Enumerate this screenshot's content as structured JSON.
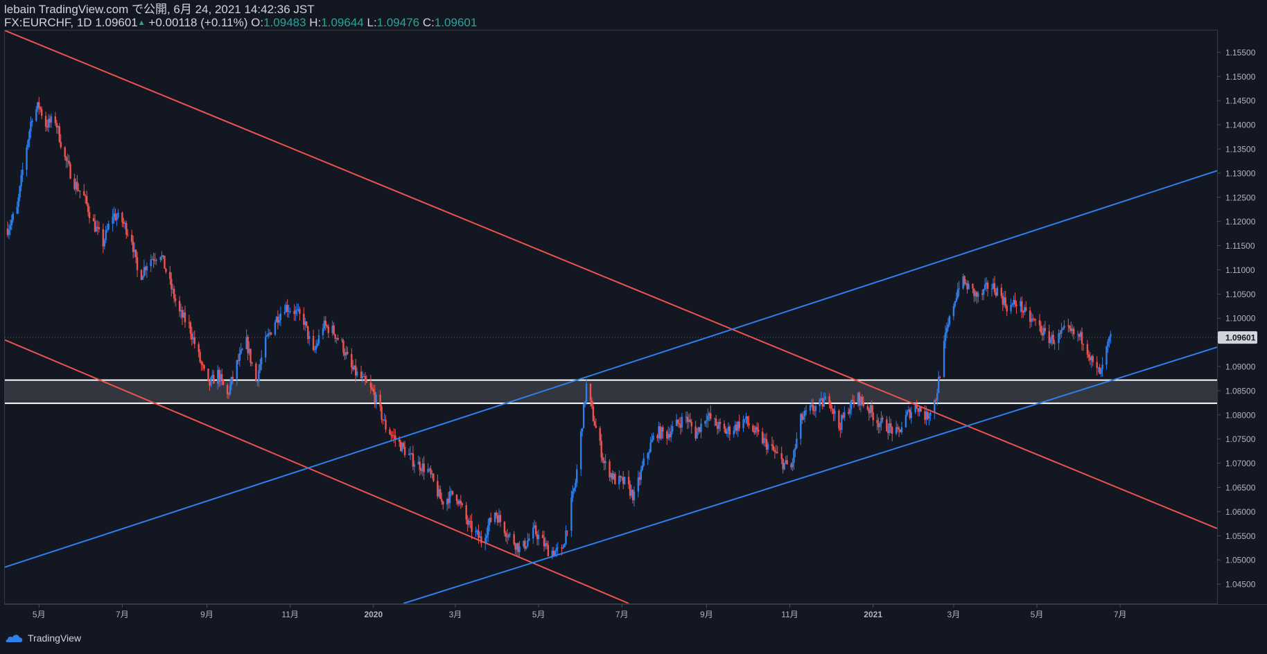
{
  "header": {
    "publish_line": "lebain TradingView.com で公開, 6月 24, 2021 14:42:36 JST",
    "symbol": "FX:EURCHF, 1D",
    "last": "1.09601",
    "change_arrow": "▲",
    "change": "+0.00118 (+0.11%)",
    "o_label": "O:",
    "o_value": "1.09483",
    "h_label": "H:",
    "h_value": "1.09644",
    "l_label": "L:",
    "l_value": "1.09476",
    "c_label": "C:",
    "c_value": "1.09601"
  },
  "footer": {
    "brand": "TradingView"
  },
  "colors": {
    "background": "#131722",
    "bull": "#2f80ed",
    "bear": "#ef5350",
    "zone_line": "#ffffff",
    "zone_fill": "#3a3c44",
    "axis_text": "#b2b5be",
    "price_tag": "#d1d4dc"
  },
  "chart_data": {
    "type": "candlestick",
    "symbol": "FX:EURCHF",
    "interval": "1D",
    "y_range": [
      1.041,
      1.1595
    ],
    "y_ticks": [
      "1.04500",
      "1.05000",
      "1.05500",
      "1.06000",
      "1.06500",
      "1.07000",
      "1.07500",
      "1.08000",
      "1.08500",
      "1.09000",
      "1.09500",
      "1.10000",
      "1.10500",
      "1.11000",
      "1.11500",
      "1.12000",
      "1.12500",
      "1.13000",
      "1.13500",
      "1.14000",
      "1.14500",
      "1.15000",
      "1.15500"
    ],
    "x_range": [
      "2019-04-06",
      "2021-09-10"
    ],
    "x_ticks": [
      {
        "date": "2019-05-01",
        "label": "5月"
      },
      {
        "date": "2019-07-01",
        "label": "7月"
      },
      {
        "date": "2019-09-01",
        "label": "9月"
      },
      {
        "date": "2019-11-01",
        "label": "11月"
      },
      {
        "date": "2020-01-01",
        "label": "2020"
      },
      {
        "date": "2020-03-01",
        "label": "3月"
      },
      {
        "date": "2020-05-01",
        "label": "5月"
      },
      {
        "date": "2020-07-01",
        "label": "7月"
      },
      {
        "date": "2020-09-01",
        "label": "9月"
      },
      {
        "date": "2020-11-01",
        "label": "11月"
      },
      {
        "date": "2021-01-01",
        "label": "2021"
      },
      {
        "date": "2021-03-01",
        "label": "3月"
      },
      {
        "date": "2021-05-01",
        "label": "5月"
      },
      {
        "date": "2021-07-01",
        "label": "7月"
      }
    ],
    "last_price": "1.09601",
    "close_path": [
      [
        "2019-04-08",
        1.1185
      ],
      [
        "2019-04-15",
        1.1225
      ],
      [
        "2019-04-20",
        1.1325
      ],
      [
        "2019-04-26",
        1.142
      ],
      [
        "2019-05-01",
        1.144
      ],
      [
        "2019-05-06",
        1.14
      ],
      [
        "2019-05-13",
        1.141
      ],
      [
        "2019-05-20",
        1.133
      ],
      [
        "2019-05-27",
        1.128
      ],
      [
        "2019-06-03",
        1.125
      ],
      [
        "2019-06-10",
        1.1195
      ],
      [
        "2019-06-17",
        1.1155
      ],
      [
        "2019-06-24",
        1.1215
      ],
      [
        "2019-07-01",
        1.12
      ],
      [
        "2019-07-08",
        1.1165
      ],
      [
        "2019-07-13",
        1.108
      ],
      [
        "2019-07-20",
        1.112
      ],
      [
        "2019-07-29",
        1.1135
      ],
      [
        "2019-08-05",
        1.107
      ],
      [
        "2019-08-12",
        1.101
      ],
      [
        "2019-08-19",
        1.0985
      ],
      [
        "2019-08-26",
        1.092
      ],
      [
        "2019-09-02",
        1.086
      ],
      [
        "2019-09-09",
        1.0885
      ],
      [
        "2019-09-16",
        1.084
      ],
      [
        "2019-09-23",
        1.0905
      ],
      [
        "2019-09-30",
        1.095
      ],
      [
        "2019-10-07",
        1.087
      ],
      [
        "2019-10-14",
        1.095
      ],
      [
        "2019-10-21",
        1.0995
      ],
      [
        "2019-10-28",
        1.1025
      ],
      [
        "2019-11-04",
        1.1015
      ],
      [
        "2019-11-11",
        1.0995
      ],
      [
        "2019-11-18",
        1.0925
      ],
      [
        "2019-11-25",
        1.0985
      ],
      [
        "2019-12-02",
        1.0975
      ],
      [
        "2019-12-09",
        1.0945
      ],
      [
        "2019-12-16",
        1.0895
      ],
      [
        "2019-12-23",
        1.0875
      ],
      [
        "2020-01-01",
        1.0845
      ],
      [
        "2020-01-10",
        1.0775
      ],
      [
        "2020-01-20",
        1.074
      ],
      [
        "2020-01-30",
        1.0705
      ],
      [
        "2020-02-10",
        1.0685
      ],
      [
        "2020-02-20",
        1.062
      ],
      [
        "2020-03-01",
        1.064
      ],
      [
        "2020-03-10",
        1.0575
      ],
      [
        "2020-03-20",
        1.054
      ],
      [
        "2020-03-30",
        1.06
      ],
      [
        "2020-04-08",
        1.0555
      ],
      [
        "2020-04-18",
        1.052
      ],
      [
        "2020-04-28",
        1.056
      ],
      [
        "2020-05-08",
        1.052
      ],
      [
        "2020-05-18",
        1.0515
      ],
      [
        "2020-05-28",
        1.066
      ],
      [
        "2020-06-05",
        1.086
      ],
      [
        "2020-06-10",
        1.0795
      ],
      [
        "2020-06-18",
        1.07
      ],
      [
        "2020-06-26",
        1.0665
      ],
      [
        "2020-07-03",
        1.066
      ],
      [
        "2020-07-10",
        1.063
      ],
      [
        "2020-07-18",
        1.071
      ],
      [
        "2020-07-26",
        1.0765
      ],
      [
        "2020-08-03",
        1.076
      ],
      [
        "2020-08-10",
        1.078
      ],
      [
        "2020-08-17",
        1.0795
      ],
      [
        "2020-08-24",
        1.076
      ],
      [
        "2020-09-01",
        1.08
      ],
      [
        "2020-09-08",
        1.078
      ],
      [
        "2020-09-15",
        1.0765
      ],
      [
        "2020-09-22",
        1.0775
      ],
      [
        "2020-09-29",
        1.079
      ],
      [
        "2020-10-06",
        1.0765
      ],
      [
        "2020-10-13",
        1.0745
      ],
      [
        "2020-10-20",
        1.0725
      ],
      [
        "2020-10-27",
        1.07
      ],
      [
        "2020-11-02",
        1.069
      ],
      [
        "2020-11-09",
        1.079
      ],
      [
        "2020-11-16",
        1.081
      ],
      [
        "2020-11-23",
        1.082
      ],
      [
        "2020-11-30",
        1.0835
      ],
      [
        "2020-12-07",
        1.0775
      ],
      [
        "2020-12-14",
        1.0815
      ],
      [
        "2020-12-21",
        1.0835
      ],
      [
        "2020-12-28",
        1.0815
      ],
      [
        "2021-01-05",
        1.0785
      ],
      [
        "2021-01-12",
        1.0775
      ],
      [
        "2021-01-19",
        1.076
      ],
      [
        "2021-01-26",
        1.08
      ],
      [
        "2021-02-02",
        1.082
      ],
      [
        "2021-02-09",
        1.0795
      ],
      [
        "2021-02-16",
        1.0835
      ],
      [
        "2021-02-23",
        1.096
      ],
      [
        "2021-03-01",
        1.103
      ],
      [
        "2021-03-06",
        1.108
      ],
      [
        "2021-03-13",
        1.106
      ],
      [
        "2021-03-20",
        1.104
      ],
      [
        "2021-03-27",
        1.107
      ],
      [
        "2021-04-03",
        1.1055
      ],
      [
        "2021-04-10",
        1.102
      ],
      [
        "2021-04-17",
        1.1035
      ],
      [
        "2021-04-24",
        1.1
      ],
      [
        "2021-05-01",
        1.099
      ],
      [
        "2021-05-08",
        1.096
      ],
      [
        "2021-05-15",
        1.0955
      ],
      [
        "2021-05-22",
        1.0975
      ],
      [
        "2021-05-29",
        1.0965
      ],
      [
        "2021-06-05",
        1.0955
      ],
      [
        "2021-06-12",
        1.0895
      ],
      [
        "2021-06-17",
        1.0885
      ],
      [
        "2021-06-20",
        1.0925
      ],
      [
        "2021-06-24",
        1.096
      ]
    ],
    "trendlines": [
      {
        "name": "upper-red",
        "color": "#ef5350",
        "p1": [
          "2019-04-06",
          1.1595
        ],
        "p2": [
          "2021-09-10",
          1.0565
        ]
      },
      {
        "name": "lower-red",
        "color": "#ef5350",
        "p1": [
          "2019-04-06",
          1.0955
        ],
        "p2": [
          "2020-07-06",
          1.041
        ]
      },
      {
        "name": "upper-blue",
        "color": "#2f80ed",
        "p1": [
          "2019-04-06",
          1.0485
        ],
        "p2": [
          "2021-09-10",
          1.1305
        ]
      },
      {
        "name": "lower-blue",
        "color": "#2f80ed",
        "p1": [
          "2020-01-23",
          1.041
        ],
        "p2": [
          "2021-09-10",
          1.094
        ]
      }
    ],
    "zone": {
      "top": 1.0872,
      "bottom": 1.0824
    }
  }
}
